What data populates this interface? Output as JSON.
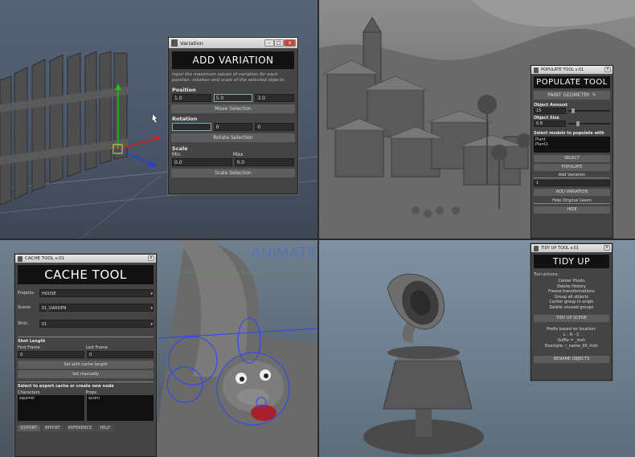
{
  "variation": {
    "window_title": "Variation",
    "banner": "ADD VARIATION",
    "description": "Input the maximum values of variation for each position, rotation and scale of the selected objects.",
    "position_label": "Position",
    "position_values": [
      "1.0",
      "5.0",
      "3.0"
    ],
    "move_button": "Move Selection",
    "rotation_label": "Rotation",
    "rotation_values": [
      "",
      "0",
      "0"
    ],
    "rotate_button": "Rotate Selection",
    "scale_label": "Scale",
    "min_label": "Min",
    "max_label": "Max",
    "scale_min": "0.0",
    "scale_max": "0.0",
    "scale_button": "Scale Selection"
  },
  "populate": {
    "window_title": "POPULATE TOOL v.01",
    "banner": "POPULATE TOOL",
    "paint_button": "PAINT GEOMETRY",
    "object_amount_label": "Object Amount",
    "object_amount_value": "15",
    "object_size_label": "Object Size",
    "object_size_value": "0.8",
    "select_models_label": "Select models to populate with",
    "models": [
      "Plant",
      "Plant1"
    ],
    "select_button": "SELECT",
    "populate_button": "POPULATE",
    "add_variation_label": "Add Variation",
    "variation_value": "1",
    "add_variation_button": "ADD VARIATION",
    "hide_label": "Hide Original Geom",
    "hide_button": "HIDE"
  },
  "cache": {
    "window_title": "CACHE TOOL v.01",
    "banner": "CACHE TOOL",
    "project_label": "Projects:",
    "project_value": "HOUSE",
    "scene_label": "Scene:",
    "scene_value": "01_GARDEN",
    "shot_label": "Shot:",
    "shot_value": "01",
    "shot_length_label": "Shot Length",
    "first_frame_label": "First Frame",
    "last_frame_label": "Last Frame",
    "first_frame_value": "0",
    "last_frame_value": "0",
    "cache_length_button": "Set with cache length",
    "manual_button": "Set manually",
    "select_export_label": "Select to export cache or create new node",
    "characters_label": "Characters",
    "props_label": "Props",
    "character_item": "squirrel",
    "prop_item": "acorn",
    "tabs": [
      "EXPORT",
      "IMPORT",
      "REFERENCE",
      "HELP"
    ]
  },
  "tidy": {
    "window_title": "TIDY UP TOOL v.01",
    "banner": "TIDY UP",
    "actions_label": "Tool actions:",
    "actions": [
      "Center Pivots",
      "Delete History",
      "Freeze transformations",
      "Group all objects",
      "Center group in origin",
      "Delete unused groups"
    ],
    "tidy_button": "TIDY UP SCENE",
    "prefix_lines": [
      "Prefix based on location:",
      "L - R - C",
      "Suffix = _msh",
      "Example: r_name_00_msh"
    ],
    "rename_button": "RENAME OBJECTS"
  },
  "viewport": {
    "animation_text": "ANIMATIO"
  },
  "colors": {
    "panel_bg": "#444444",
    "banner_bg": "#111111",
    "button_bg": "#5d5d5d",
    "field_bg": "#2b2b2b",
    "axis_x": "#d02020",
    "axis_y": "#20c020",
    "axis_z": "#2040e0"
  }
}
